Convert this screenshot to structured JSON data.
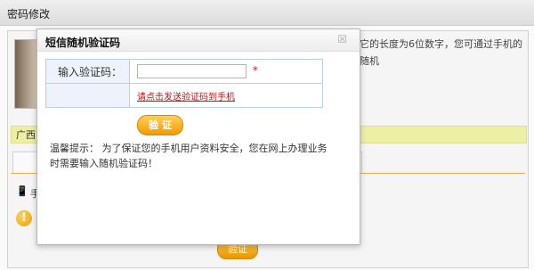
{
  "page": {
    "title": "密码修改",
    "note": "它的长度为6位数字，您可通过手机的随机",
    "region_bar": "广西",
    "phone_label": "手",
    "bottom_button": "验证"
  },
  "modal": {
    "title": "短信随机验证码",
    "close_symbol": "☒",
    "code_label": "输入验证码：",
    "code_value": "",
    "code_placeholder": "",
    "required_mark": "*",
    "send_link": "请点击发送验证码到手机",
    "verify_button": "验证",
    "tip_label": "温馨提示：",
    "tip_text": "为了保证您的手机用户资料安全，您在网上办理业务时需要输入随机验证码！"
  },
  "colors": {
    "accent_orange": "#f29a00",
    "link_red": "#b5161b",
    "table_border": "#b8cfe8"
  }
}
